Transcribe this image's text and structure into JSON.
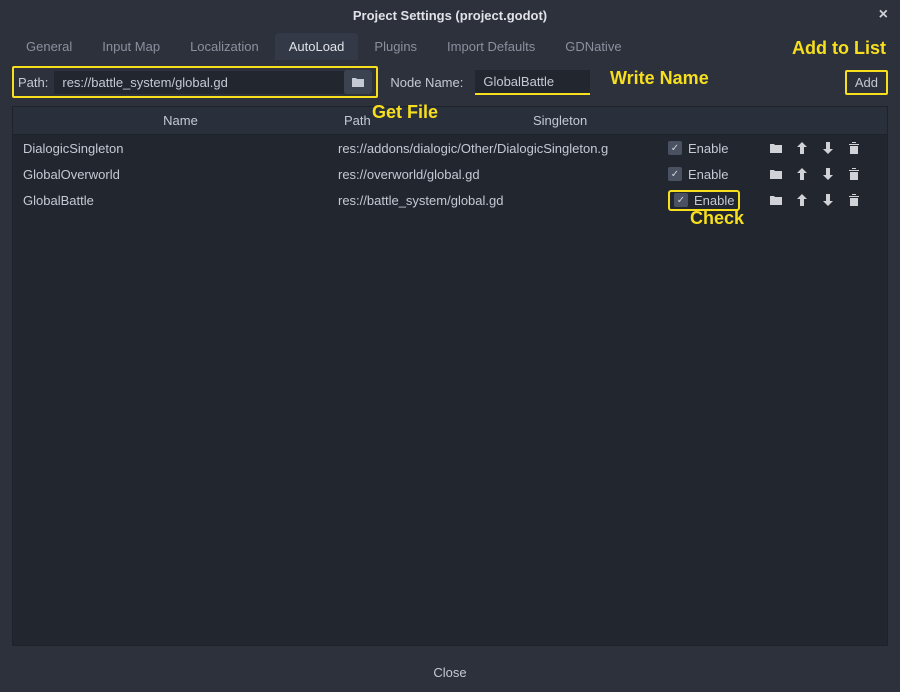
{
  "title": "Project Settings (project.godot)",
  "tabs": [
    "General",
    "Input Map",
    "Localization",
    "AutoLoad",
    "Plugins",
    "Import Defaults",
    "GDNative"
  ],
  "active_tab_index": 3,
  "input": {
    "path_label": "Path:",
    "path_value": "res://battle_system/global.gd",
    "node_name_label": "Node Name:",
    "node_name_value": "GlobalBattle",
    "add_button": "Add"
  },
  "annotations": {
    "add_to_list": "Add to List",
    "write_name": "Write Name",
    "get_file": "Get File",
    "check": "Check"
  },
  "columns": {
    "name": "Name",
    "path": "Path",
    "singleton": "Singleton"
  },
  "rows": [
    {
      "name": "DialogicSingleton",
      "path": "res://addons/dialogic/Other/DialogicSingleton.g",
      "enable": "Enable",
      "highlight": false
    },
    {
      "name": "GlobalOverworld",
      "path": "res://overworld/global.gd",
      "enable": "Enable",
      "highlight": false
    },
    {
      "name": "GlobalBattle",
      "path": "res://battle_system/global.gd",
      "enable": "Enable",
      "highlight": true
    }
  ],
  "close": "Close"
}
